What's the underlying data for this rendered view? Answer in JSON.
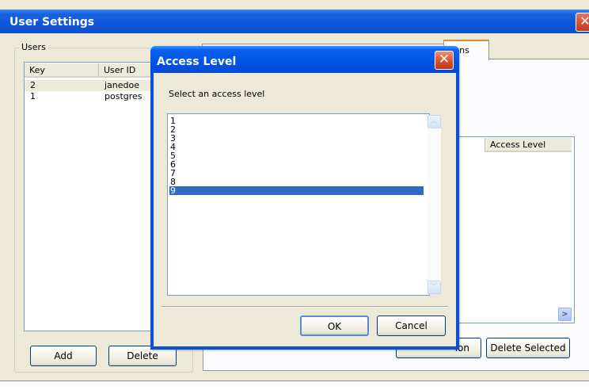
{
  "main_window": {
    "title": "User Settings"
  },
  "users": {
    "group_label": "Users",
    "columns": [
      "Key",
      "User ID"
    ],
    "rows": [
      {
        "key": "2",
        "user_id": "janedoe"
      },
      {
        "key": "1",
        "user_id": "postgres"
      }
    ],
    "add_label": "Add",
    "delete_label": "Delete"
  },
  "right_panel": {
    "tab_label": "tions",
    "access_column": "Access Level",
    "add_button_fragment": "ion",
    "delete_selected_label": "Delete Selected"
  },
  "dialog": {
    "title": "Access Level",
    "prompt": "Select an access level",
    "levels": [
      "1",
      "2",
      "3",
      "4",
      "5",
      "6",
      "7",
      "8",
      "9"
    ],
    "selected": "9",
    "ok_label": "OK",
    "cancel_label": "Cancel"
  }
}
